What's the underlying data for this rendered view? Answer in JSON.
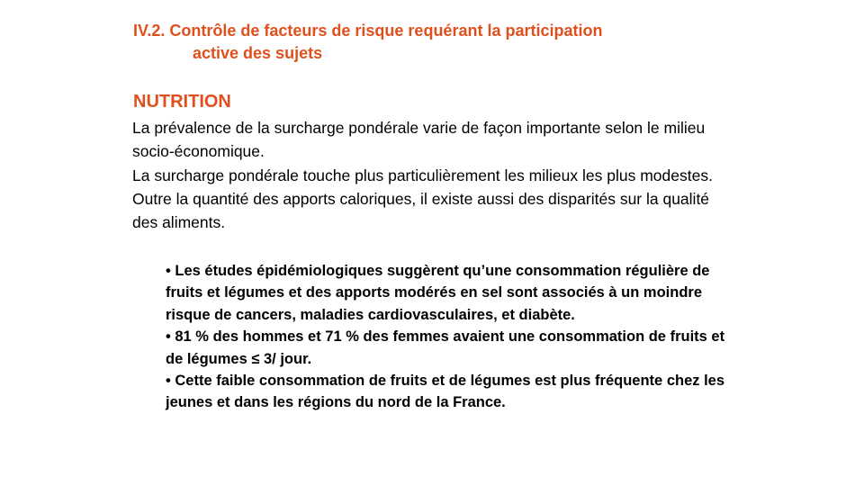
{
  "slide": {
    "heading_line1": "IV.2. Contrôle de facteurs de risque requérant la participation",
    "heading_line2": "active des sujets",
    "section_title": "NUTRITION",
    "paragraphs": [
      "La prévalence de la surcharge pondérale varie de façon importante selon le milieu socio-économique.",
      "La surcharge pondérale touche plus particulièrement les milieux les plus modestes.",
      "Outre la quantité des apports caloriques, il existe aussi des disparités sur la qualité des aliments."
    ],
    "bullet_symbol": "•",
    "bullets": [
      "Les études épidémiologiques suggèrent qu’une consommation régulière de fruits et légumes et des apports modérés en sel sont associés à un moindre risque de cancers, maladies cardiovasculaires, et diabète.",
      "81 % des hommes et 71 % des femmes avaient une consommation de fruits et de légumes ≤ 3/ jour.",
      "Cette faible consommation de fruits et de légumes est plus fréquente chez les jeunes et dans les régions du nord de la France."
    ]
  },
  "colors": {
    "accent": "#e0501d",
    "text": "#000000",
    "background": "#ffffff"
  }
}
